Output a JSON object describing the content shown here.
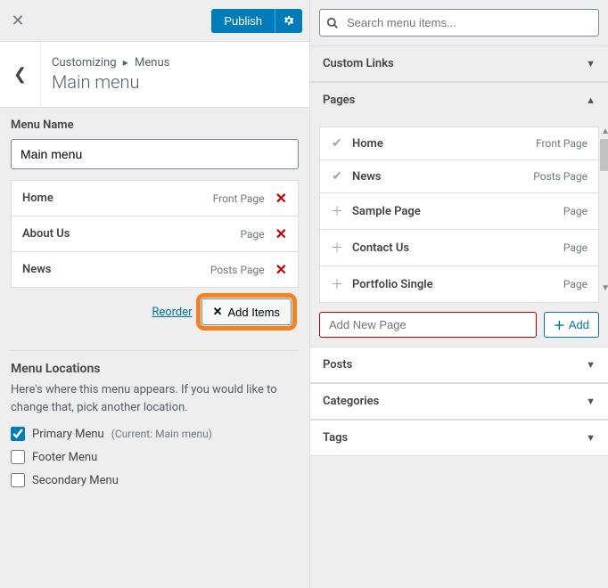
{
  "topbar": {
    "publish": "Publish"
  },
  "breadcrumb": {
    "root": "Customizing",
    "section": "Menus",
    "title": "Main menu"
  },
  "menu_name": {
    "label": "Menu Name",
    "value": "Main menu"
  },
  "menu_items": [
    {
      "title": "Home",
      "type": "Front Page"
    },
    {
      "title": "About Us",
      "type": "Page"
    },
    {
      "title": "News",
      "type": "Posts Page"
    }
  ],
  "actions": {
    "reorder": "Reorder",
    "add_items": "Add Items"
  },
  "locations": {
    "heading": "Menu Locations",
    "description": "Here's where this menu appears. If you would like to change that, pick another location.",
    "options": [
      {
        "label": "Primary Menu",
        "checked": true,
        "current": "(Current: Main menu)"
      },
      {
        "label": "Footer Menu",
        "checked": false,
        "current": ""
      },
      {
        "label": "Secondary Menu",
        "checked": false,
        "current": ""
      }
    ]
  },
  "search": {
    "placeholder": "Search menu items..."
  },
  "accordion": {
    "custom_links": "Custom Links",
    "pages": "Pages",
    "posts": "Posts",
    "categories": "Categories",
    "tags": "Tags"
  },
  "pages": [
    {
      "title": "Home",
      "type": "Front Page",
      "added": true
    },
    {
      "title": "News",
      "type": "Posts Page",
      "added": true
    },
    {
      "title": "Sample Page",
      "type": "Page",
      "added": false
    },
    {
      "title": "Contact Us",
      "type": "Page",
      "added": false
    },
    {
      "title": "Portfolio Single",
      "type": "Page",
      "added": false
    }
  ],
  "add_new": {
    "placeholder": "Add New Page",
    "button": "Add"
  }
}
